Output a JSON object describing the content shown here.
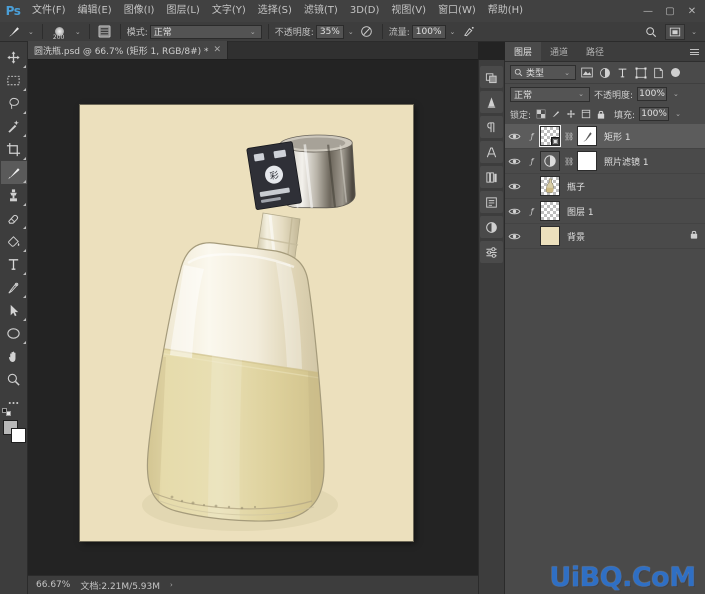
{
  "app": {
    "logo": "Ps",
    "menus": [
      {
        "label": "文件(F)"
      },
      {
        "label": "编辑(E)"
      },
      {
        "label": "图像(I)"
      },
      {
        "label": "图层(L)"
      },
      {
        "label": "文字(Y)"
      },
      {
        "label": "选择(S)"
      },
      {
        "label": "滤镜(T)"
      },
      {
        "label": "3D(D)"
      },
      {
        "label": "视图(V)"
      },
      {
        "label": "窗口(W)"
      },
      {
        "label": "帮助(H)"
      }
    ],
    "window_controls": {
      "minimize": "—",
      "maximize": "▢",
      "close": "✕"
    }
  },
  "options_bar": {
    "brush_size": "200",
    "mode_label": "模式:",
    "mode_value": "正常",
    "opacity_label": "不透明度:",
    "opacity_value": "35%",
    "flow_label": "流量:",
    "flow_value": "100%",
    "caret": "⌄"
  },
  "toolbar": {
    "tools": [
      {
        "name": "move-tool",
        "label": "移动工具"
      },
      {
        "name": "marquee-tool",
        "label": "矩形选框工具"
      },
      {
        "name": "lasso-tool",
        "label": "套索工具"
      },
      {
        "name": "magic-wand-tool",
        "label": "快速选择工具"
      },
      {
        "name": "crop-tool",
        "label": "裁剪工具"
      },
      {
        "name": "brush-tool",
        "label": "画笔工具"
      },
      {
        "name": "clone-stamp-tool",
        "label": "仿制图章工具"
      },
      {
        "name": "eraser-tool",
        "label": "橡皮擦工具"
      },
      {
        "name": "paint-bucket-tool",
        "label": "油漆桶工具"
      },
      {
        "name": "type-tool",
        "label": "横排文字工具"
      },
      {
        "name": "pen-tool",
        "label": "钢笔工具"
      },
      {
        "name": "path-selection-tool",
        "label": "路径选择工具"
      },
      {
        "name": "ellipse-tool",
        "label": "椭圆工具"
      },
      {
        "name": "hand-tool",
        "label": "抓手工具"
      },
      {
        "name": "zoom-tool",
        "label": "缩放工具"
      },
      {
        "name": "more-tools",
        "label": "更多工具"
      }
    ],
    "active_tool": "brush-tool",
    "foreground_color": "#b8b8b8",
    "background_color": "#ffffff"
  },
  "document": {
    "tab_title": "圆洗瓶.psd @ 66.7% (矩形 1, RGB/8#) *",
    "tab_close": "✕",
    "canvas_bg_color": "#ece0bd",
    "liquid_color": "#ded2a0"
  },
  "status_bar": {
    "zoom": "66.67%",
    "doc_info": "文档:2.21M/5.93M",
    "caret": "›"
  },
  "top_right": {
    "search_icon": "search-icon",
    "workspace_icon": "workspace-switcher-icon",
    "caret": "⌄"
  },
  "icon_dock": {
    "items": [
      {
        "name": "color-swatches-icon"
      },
      {
        "name": "adjustments-icon"
      },
      {
        "name": "paragraph-styles-icon"
      },
      {
        "name": "character-icon"
      },
      {
        "name": "libraries-icon"
      },
      {
        "name": "history-icon"
      },
      {
        "name": "properties-icon"
      },
      {
        "name": "adjustments-panel-icon"
      }
    ]
  },
  "layers_panel": {
    "tabs": [
      {
        "label": "图层",
        "active": true
      },
      {
        "label": "通道",
        "active": false
      },
      {
        "label": "路径",
        "active": false
      }
    ],
    "filter": {
      "search_icon": "search-icon",
      "type_label": "类型",
      "caret": "⌄",
      "filter_icons": [
        "pixel-filter-icon",
        "adjustment-filter-icon",
        "type-filter-icon",
        "shape-filter-icon",
        "smartobject-filter-icon"
      ],
      "toggle": "filter-toggle"
    },
    "blend": {
      "mode_value": "正常",
      "caret": "⌄",
      "opacity_label": "不透明度:",
      "opacity_value": "100%"
    },
    "lock": {
      "lock_label": "锁定:",
      "icons": [
        "lock-transparent-icon",
        "lock-image-icon",
        "lock-position-icon",
        "lock-artboard-icon",
        "lock-all-icon"
      ],
      "fill_label": "填充:",
      "fill_value": "100%"
    },
    "layers": [
      {
        "name": "矩形 1",
        "visible": true,
        "selected": true,
        "has_fx": true,
        "has_link": true,
        "has_mask": true,
        "thumb_type": "shape",
        "locked": false
      },
      {
        "name": "照片滤镜 1",
        "visible": true,
        "selected": false,
        "has_fx": true,
        "has_link": true,
        "has_mask": true,
        "thumb_type": "adjustment",
        "locked": false
      },
      {
        "name": "瓶子",
        "visible": true,
        "selected": false,
        "has_fx": false,
        "has_link": false,
        "has_mask": false,
        "thumb_type": "bottle",
        "locked": false
      },
      {
        "name": "图层 1",
        "visible": true,
        "selected": false,
        "has_fx": true,
        "has_link": false,
        "has_mask": false,
        "thumb_type": "transparent",
        "locked": false
      },
      {
        "name": "背景",
        "visible": true,
        "selected": false,
        "has_fx": false,
        "has_link": false,
        "has_mask": false,
        "thumb_type": "solid",
        "locked": true,
        "lock_glyph": "🔒"
      }
    ]
  },
  "watermark": {
    "text": "UiBQ.CoM",
    "color": "#2f6fc4"
  }
}
